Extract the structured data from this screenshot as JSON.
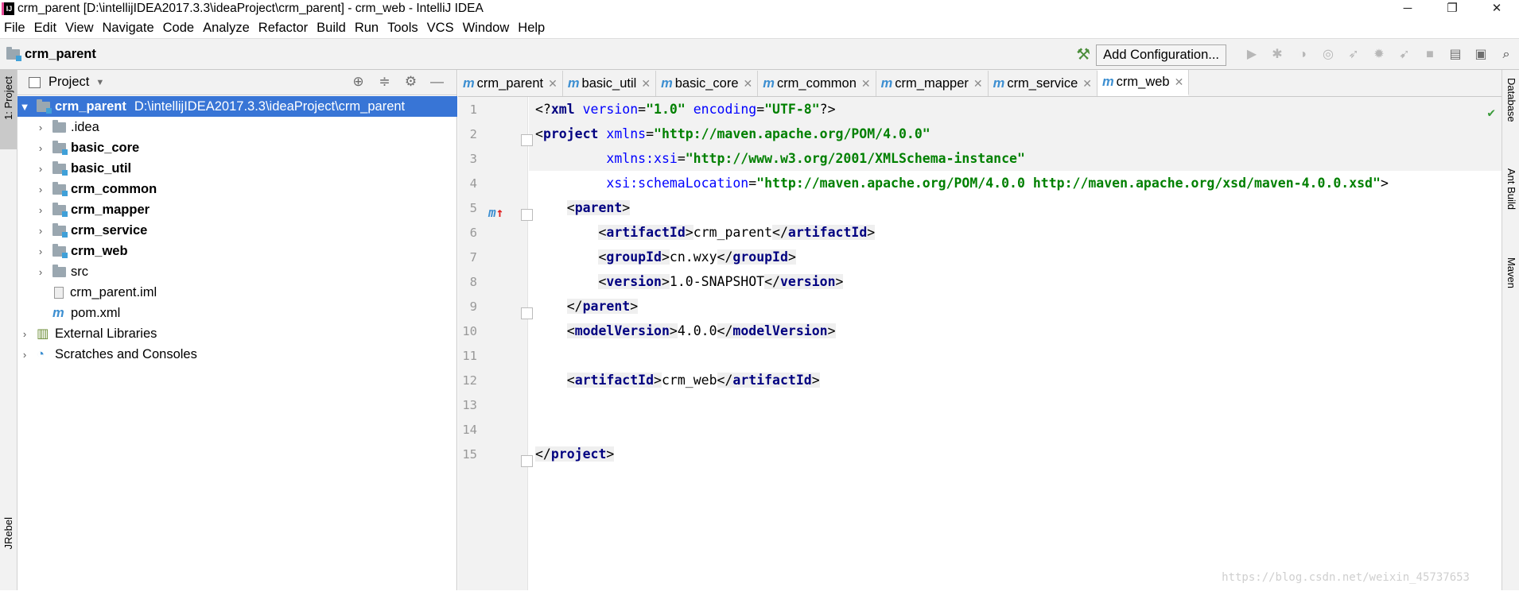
{
  "window": {
    "title": "crm_parent [D:\\intellijIDEA2017.3.3\\ideaProject\\crm_parent] - crm_web - IntelliJ IDEA",
    "logo_text": "IJ",
    "minimize": "─",
    "restore": "❐",
    "close": "✕"
  },
  "menu": [
    "File",
    "Edit",
    "View",
    "Navigate",
    "Code",
    "Analyze",
    "Refactor",
    "Build",
    "Run",
    "Tools",
    "VCS",
    "Window",
    "Help"
  ],
  "navbar": {
    "breadcrumb": "crm_parent",
    "add_configuration": "Add Configuration..."
  },
  "left_strip": {
    "project_tab": "1: Project",
    "jrebel_tab": "JRebel"
  },
  "right_strip": {
    "database_tab": "Database",
    "ant_tab": "Ant Build",
    "maven_tab": "Maven"
  },
  "project_panel": {
    "title": "Project",
    "tree": [
      {
        "label": "crm_parent",
        "path": "D:\\intellijIDEA2017.3.3\\ideaProject\\crm_parent",
        "bold": true,
        "level": 0,
        "arrow": "▼",
        "icon": "module-folder-icon",
        "selected": true
      },
      {
        "label": ".idea",
        "bold": false,
        "level": 1,
        "arrow": "›",
        "icon": "folder-icon"
      },
      {
        "label": "basic_core",
        "bold": true,
        "level": 1,
        "arrow": "›",
        "icon": "module-folder-icon"
      },
      {
        "label": "basic_util",
        "bold": true,
        "level": 1,
        "arrow": "›",
        "icon": "module-folder-icon"
      },
      {
        "label": "crm_common",
        "bold": true,
        "level": 1,
        "arrow": "›",
        "icon": "module-folder-icon"
      },
      {
        "label": "crm_mapper",
        "bold": true,
        "level": 1,
        "arrow": "›",
        "icon": "module-folder-icon"
      },
      {
        "label": "crm_service",
        "bold": true,
        "level": 1,
        "arrow": "›",
        "icon": "module-folder-icon"
      },
      {
        "label": "crm_web",
        "bold": true,
        "level": 1,
        "arrow": "›",
        "icon": "module-folder-icon"
      },
      {
        "label": "src",
        "bold": false,
        "level": 1,
        "arrow": "›",
        "icon": "folder-icon"
      },
      {
        "label": "crm_parent.iml",
        "bold": false,
        "level": 1,
        "arrow": "",
        "icon": "iml-file-icon"
      },
      {
        "label": "pom.xml",
        "bold": false,
        "level": 1,
        "arrow": "",
        "icon": "maven-file-icon"
      },
      {
        "label": "External Libraries",
        "bold": false,
        "level": 0,
        "arrow": "›",
        "icon": "libraries-icon"
      },
      {
        "label": "Scratches and Consoles",
        "bold": false,
        "level": 0,
        "arrow": "›",
        "icon": "scratches-icon"
      }
    ]
  },
  "tabs": [
    {
      "label": "crm_parent",
      "active": false
    },
    {
      "label": "basic_util",
      "active": false
    },
    {
      "label": "basic_core",
      "active": false
    },
    {
      "label": "crm_common",
      "active": false
    },
    {
      "label": "crm_mapper",
      "active": false
    },
    {
      "label": "crm_service",
      "active": false
    },
    {
      "label": "crm_web",
      "active": true
    }
  ],
  "editor": {
    "line_numbers": [
      "1",
      "2",
      "3",
      "4",
      "5",
      "6",
      "7",
      "8",
      "9",
      "10",
      "11",
      "12",
      "13",
      "14",
      "15"
    ],
    "xml_decl": {
      "version": "\"1.0\"",
      "encoding": "\"UTF-8\""
    },
    "project_ns": "\"http://maven.apache.org/POM/4.0.0\"",
    "xsi_ns": "\"http://www.w3.org/2001/XMLSchema-instance\"",
    "schema_location": "\"http://maven.apache.org/POM/4.0.0 http://maven.apache.org/xsd/maven-4.0.0.xsd\"",
    "parent_artifact_id": "crm_parent",
    "parent_group_id": "cn.wxy",
    "parent_version": "1.0-SNAPSHOT",
    "model_version": "4.0.0",
    "artifact_id": "crm_web",
    "gutter_marker": "m"
  },
  "watermark": "https://blog.csdn.net/weixin_45737653"
}
